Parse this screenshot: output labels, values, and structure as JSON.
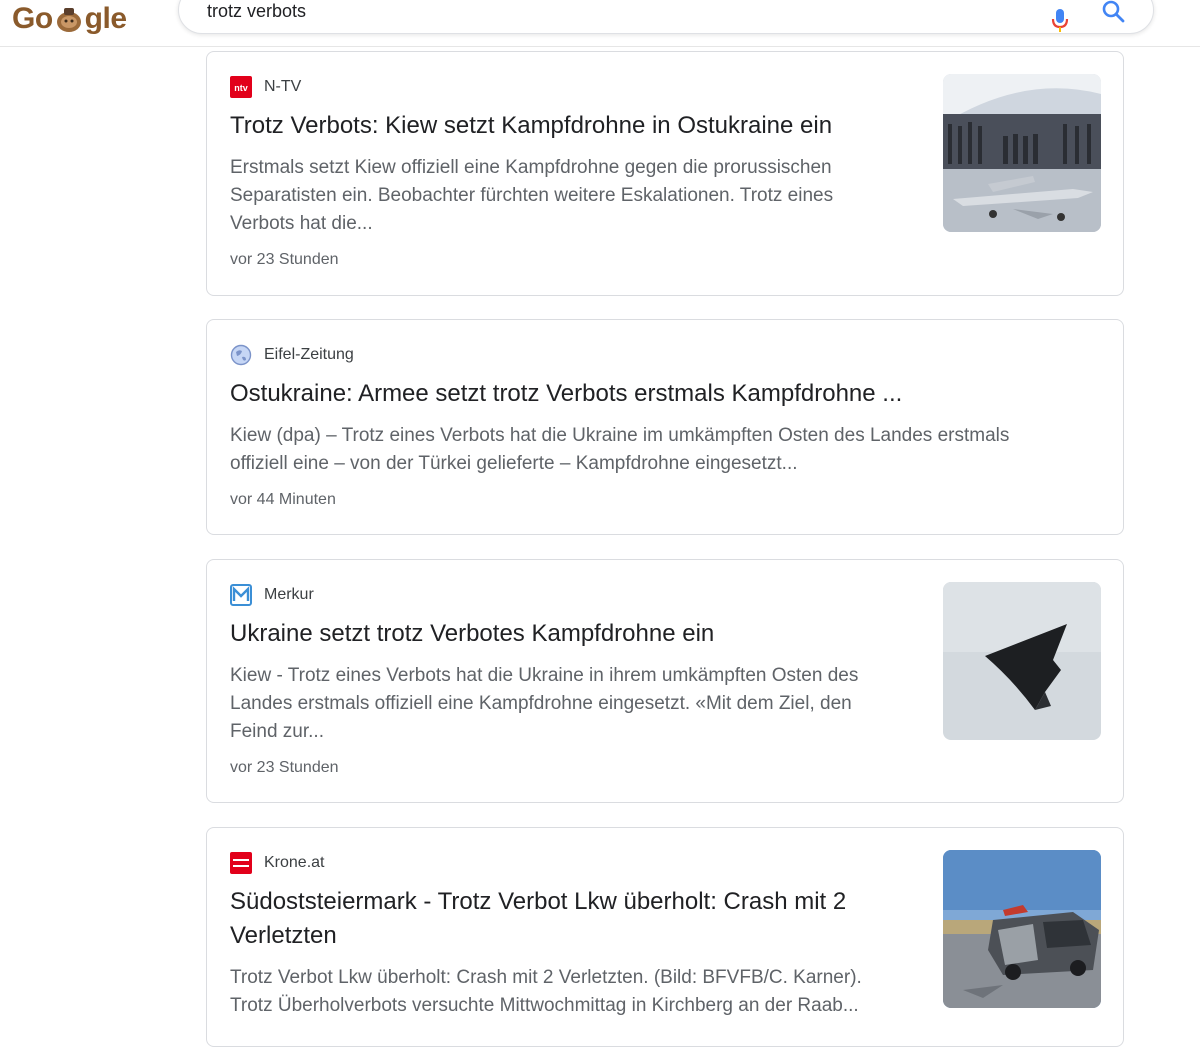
{
  "header": {
    "logo_text": "Google",
    "search_query": "trotz verbots"
  },
  "results": [
    {
      "source": "N-TV",
      "favicon": "ntv-icon",
      "favicon_color": "#e2001a",
      "title": "Trotz Verbots: Kiew setzt Kampfdrohne in Ostukraine ein",
      "snippet_lines": [
        "Erstmals setzt Kiew offiziell eine Kampfdrohne gegen die prorussischen",
        "Separatisten ein. Beobachter fürchten weitere Eskalationen. Trotz eines",
        "Verbots hat die..."
      ],
      "time": "vor 23 Stunden",
      "thumbnail": "parade-drone-photo"
    },
    {
      "source": "Eifel-Zeitung",
      "favicon": "globe-icon",
      "favicon_color": "#8ab4f8",
      "title": "Ostukraine: Armee setzt trotz Verbots erstmals Kampfdrohne ...",
      "snippet_lines": [
        "Kiew (dpa) – Trotz eines Verbots hat die Ukraine im umkämpften Osten des Landes erstmals",
        "offiziell eine – von der Türkei gelieferte – Kampfdrohne eingesetzt..."
      ],
      "time": "vor 44 Minuten"
    },
    {
      "source": "Merkur",
      "favicon": "merkur-icon",
      "favicon_color": "#3b8fd6",
      "title": "Ukraine setzt trotz Verbotes Kampfdrohne ein",
      "snippet_lines": [
        "Kiew - Trotz eines Verbots hat die Ukraine in ihrem umkämpften Osten des",
        "Landes erstmals offiziell eine Kampfdrohne eingesetzt. «Mit dem Ziel, den",
        "Feind zur..."
      ],
      "time": "vor 23 Stunden",
      "thumbnail": "flying-wing-drone-photo"
    },
    {
      "source": "Krone.at",
      "favicon": "krone-icon",
      "favicon_color": "#e2001a",
      "title_lines": [
        "Südoststeiermark - Trotz Verbot Lkw überholt: Crash mit 2",
        "Verletzten"
      ],
      "snippet_lines": [
        "Trotz Verbot Lkw überholt: Crash mit 2 Verletzten. (Bild: BFVFB/C. Karner).",
        "Trotz Überholverbots versuchte Mittwochmittag in Kirchberg an der Raab..."
      ],
      "thumbnail": "car-crash-photo"
    }
  ]
}
